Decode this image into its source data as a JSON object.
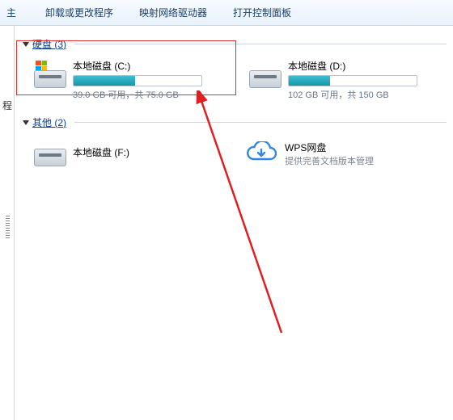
{
  "toolbar": {
    "left_char": "主",
    "items": [
      "卸载或更改程序",
      "映射网络驱动器",
      "打开控制面板"
    ]
  },
  "left_edge_char": "程",
  "groups": {
    "hdd": {
      "label": "硬盘",
      "count": 3
    },
    "other": {
      "label": "其他",
      "count": 2
    }
  },
  "drives": [
    {
      "name": "本地磁盘 (C:)",
      "stat": "39.0 GB 可用，共 75.0 GB",
      "fill_pct": 48,
      "windows": true
    },
    {
      "name": "本地磁盘 (D:)",
      "stat": "102 GB 可用，共 150 GB",
      "fill_pct": 32,
      "windows": false
    }
  ],
  "other_items": {
    "drive_f": {
      "name": "本地磁盘 (F:)"
    },
    "wps": {
      "title": "WPS网盘",
      "subtitle": "提供完善文档版本管理"
    }
  },
  "annotation": {
    "highlight_target": "drive-c"
  }
}
